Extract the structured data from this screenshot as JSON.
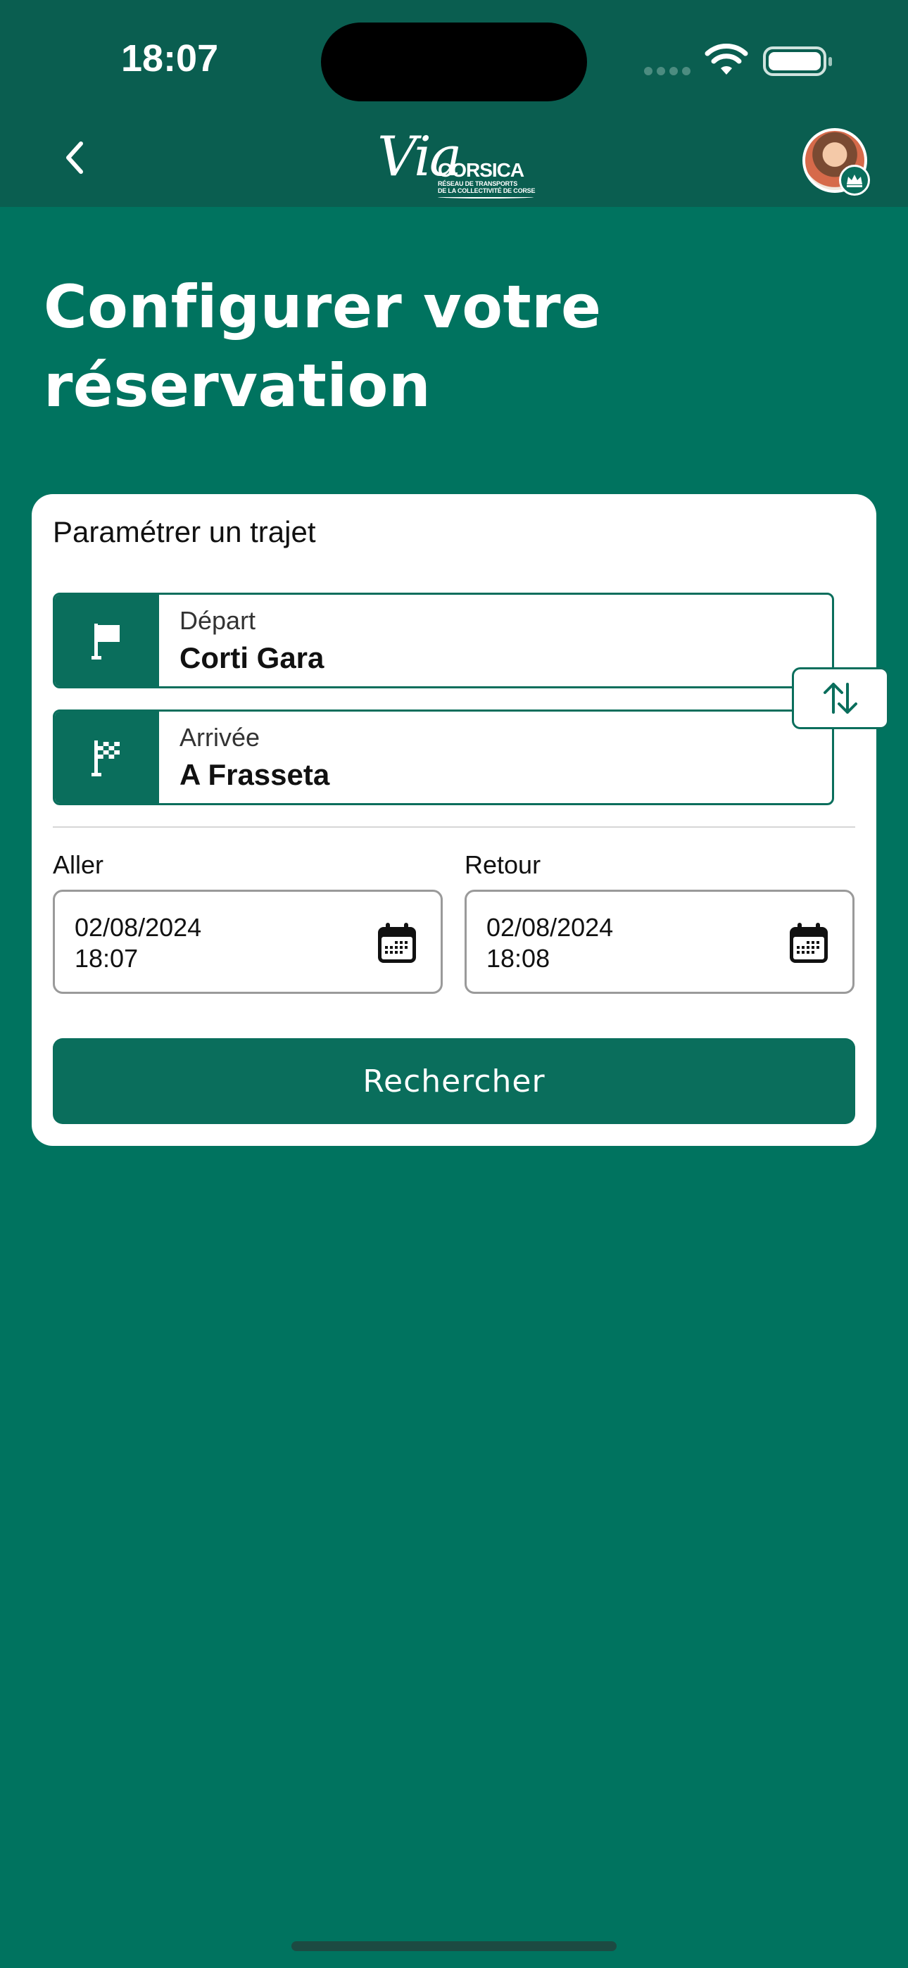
{
  "status_bar": {
    "time": "18:07"
  },
  "header": {
    "logo": {
      "via": "Via",
      "corsica": "CORSICA",
      "line1": "RÉSEAU DE TRANSPORTS",
      "line2": "DE LA COLLECTIVITÉ DE CORSE"
    }
  },
  "page": {
    "title_line1": "Configurer votre",
    "title_line2": "réservation"
  },
  "form": {
    "section_title": "Paramétrer un trajet",
    "depart": {
      "label": "Départ",
      "value": "Corti Gara"
    },
    "arrivee": {
      "label": "Arrivée",
      "value": "A Frasseta"
    },
    "aller": {
      "label": "Aller",
      "date": "02/08/2024",
      "time": "18:07"
    },
    "retour": {
      "label": "Retour",
      "date": "02/08/2024",
      "time": "18:08"
    },
    "search_label": "Rechercher"
  },
  "colors": {
    "primary": "#0a6e5c",
    "background": "#00735f",
    "header": "#0a5e50"
  },
  "icons": [
    "back-chevron-icon",
    "flag-icon",
    "checkered-flag-icon",
    "swap-arrows-icon",
    "calendar-icon",
    "crown-icon"
  ]
}
